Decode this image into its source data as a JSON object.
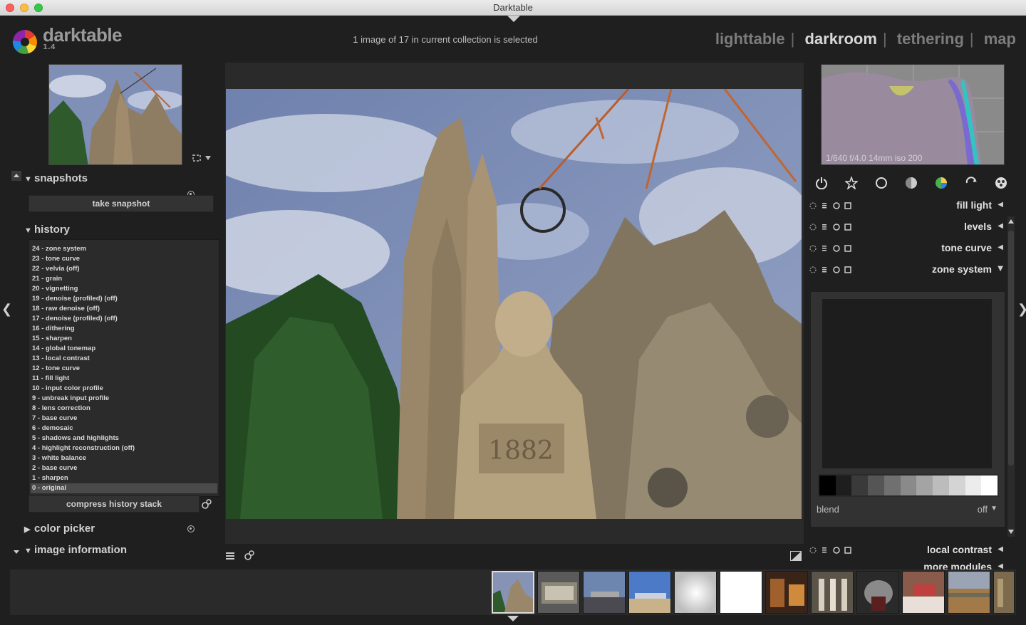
{
  "window": {
    "title": "Darktable"
  },
  "header": {
    "brand": "darktable",
    "version": "1.4",
    "status": "1 image of 17 in current collection is selected",
    "views": [
      "lighttable",
      "darkroom",
      "tethering",
      "map"
    ],
    "active_view": "darkroom"
  },
  "left": {
    "snapshots": {
      "title": "snapshots",
      "take_snapshot": "take snapshot"
    },
    "history": {
      "title": "history",
      "items": [
        "24 - zone system",
        "23 - tone curve",
        "22 - velvia  (off)",
        "21 - grain",
        "20 - vignetting",
        "19 - denoise (profiled)  (off)",
        "18 - raw denoise  (off)",
        "17 - denoise (profiled)  (off)",
        "16 - dithering",
        "15 - sharpen",
        "14 - global tonemap",
        "13 - local contrast",
        "12 - tone curve",
        "11 - fill light",
        "10 - input color profile",
        "9 - unbreak input profile",
        "8 - lens correction",
        "7 - base curve",
        "6 - demosaic",
        "5 - shadows and highlights",
        "4 - highlight reconstruction  (off)",
        "3 - white balance",
        "2 - base curve",
        "1 - sharpen",
        "0 - original"
      ],
      "compress": "compress history stack"
    },
    "color_picker": "color picker",
    "image_information": "image information"
  },
  "right": {
    "histogram_info": "1/640 f/4.0 14mm iso 200",
    "modules": [
      "fill light",
      "levels",
      "tone curve",
      "zone system"
    ],
    "blend_label": "blend",
    "blend_value": "off",
    "local_contrast": "local contrast",
    "more_modules": "more modules"
  },
  "colors": {
    "accent": "#d8d8d8",
    "panel_bg": "#1f1f1f",
    "sky": "#7d8fb8",
    "stone": "#a89676"
  }
}
